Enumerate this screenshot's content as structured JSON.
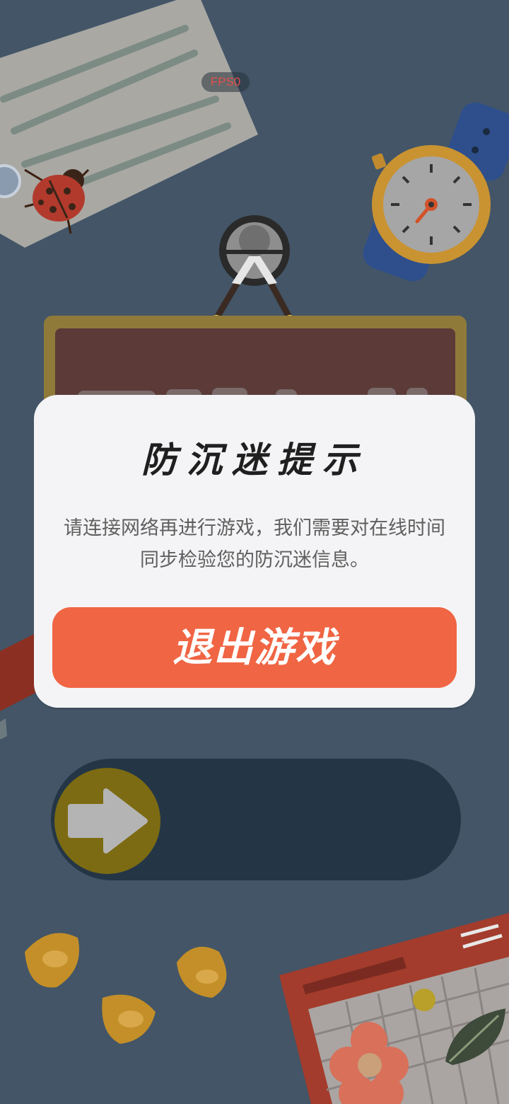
{
  "hud": {
    "fps_label": "FPS0"
  },
  "icons": {
    "note_card": "note-card-icon",
    "ladybug": "ladybug-icon",
    "watch": "watch-icon",
    "magnifier": "magnifier-icon",
    "arrow": "arrow-right-icon",
    "corn": "corn-kernel-icon",
    "calendar": "calendar-icon",
    "flower": "flower-icon",
    "leaf": "leaf-icon"
  },
  "colors": {
    "background": "#435567",
    "modal": "#f4f4f6",
    "button": "#f06543",
    "slider_track": "#243646",
    "slider_knob": "#7c6b12"
  },
  "dialog": {
    "title": "防沉迷提示",
    "message": "请连接网络再进行游戏，我们需要对在线时间同步检验您的防沉迷信息。",
    "exit_label": "退出游戏"
  }
}
